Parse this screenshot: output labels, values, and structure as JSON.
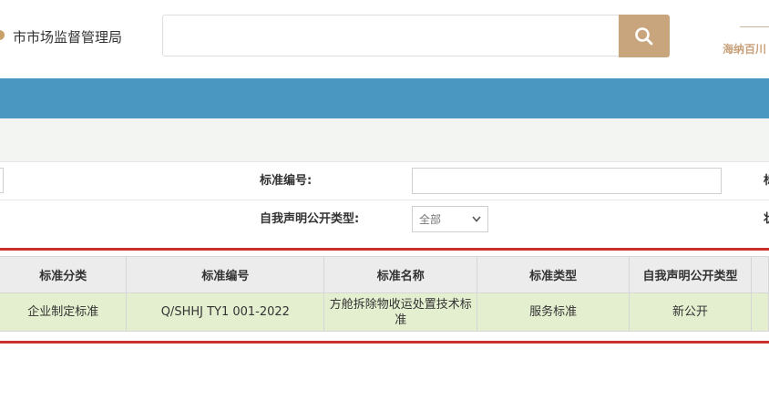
{
  "header": {
    "agency_name": "市市场监督管理局",
    "search": {
      "placeholder": "",
      "value": ""
    },
    "search_icon": "magnifier-icon",
    "slogan": "海纳百川",
    "accent_color": "#c9a57e"
  },
  "nav": {
    "band_color": "#4a97c2"
  },
  "form": {
    "std_number_label": "标准编号:",
    "std_number_value": "",
    "disclosure_type_label": "自我声明公开类型:",
    "disclosure_type_selected": "全部",
    "right_edge_label_1": "标",
    "right_edge_label_2": "状"
  },
  "results": {
    "border_color": "#c9302c",
    "columns": [
      "标准分类",
      "标准编号",
      "标准名称",
      "标准类型",
      "自我声明公开类型"
    ],
    "rows": [
      {
        "category": "企业制定标准",
        "number": "Q/SHHJ TY1 001-2022",
        "name": "方舱拆除物收运处置技术标准",
        "type": "服务标准",
        "disclosure_type": "新公开"
      }
    ]
  }
}
